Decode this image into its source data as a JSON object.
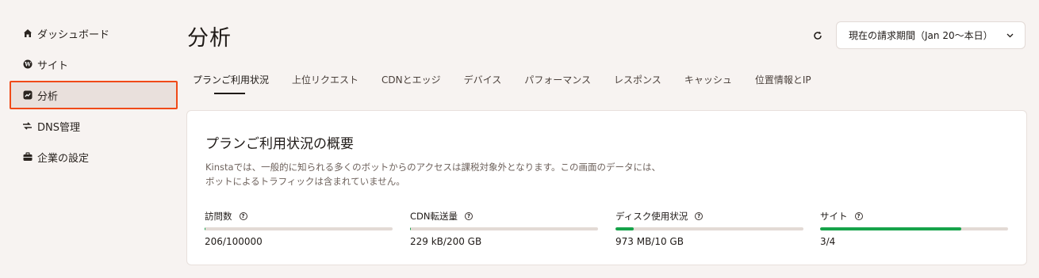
{
  "sidebar": {
    "items": [
      {
        "label": "ダッシュボード",
        "icon": "home-icon"
      },
      {
        "label": "サイト",
        "icon": "wordpress-icon"
      },
      {
        "label": "分析",
        "icon": "analytics-icon",
        "active": true
      },
      {
        "label": "DNS管理",
        "icon": "dns-icon"
      },
      {
        "label": "企業の設定",
        "icon": "briefcase-icon"
      }
    ]
  },
  "header": {
    "title": "分析",
    "period_select": "現在の請求期間（Jan 20〜本日）"
  },
  "tabs": [
    {
      "label": "プランご利用状況",
      "active": true
    },
    {
      "label": "上位リクエスト"
    },
    {
      "label": "CDNとエッジ"
    },
    {
      "label": "デバイス"
    },
    {
      "label": "パフォーマンス"
    },
    {
      "label": "レスポンス"
    },
    {
      "label": "キャッシュ"
    },
    {
      "label": "位置情報とIP"
    }
  ],
  "card": {
    "title": "プランご利用状況の概要",
    "description": "Kinstaでは、一般的に知られる多くのボットからのアクセスは課税対象外となります。この画面のデータには、ボットによるトラフィックは含まれていません。",
    "metrics": [
      {
        "label": "訪問数",
        "value": "206/100000",
        "fraction": 0.00206
      },
      {
        "label": "CDN転送量",
        "value": "229 kB/200 GB",
        "fraction": 0.0
      },
      {
        "label": "ディスク使用状況",
        "value": "973 MB/10 GB",
        "fraction": 0.097
      },
      {
        "label": "サイト",
        "value": "3/4",
        "fraction": 0.75
      }
    ]
  },
  "colors": {
    "accent": "#f04a18",
    "progress": "#16a34a",
    "background": "#f7f3f1"
  }
}
